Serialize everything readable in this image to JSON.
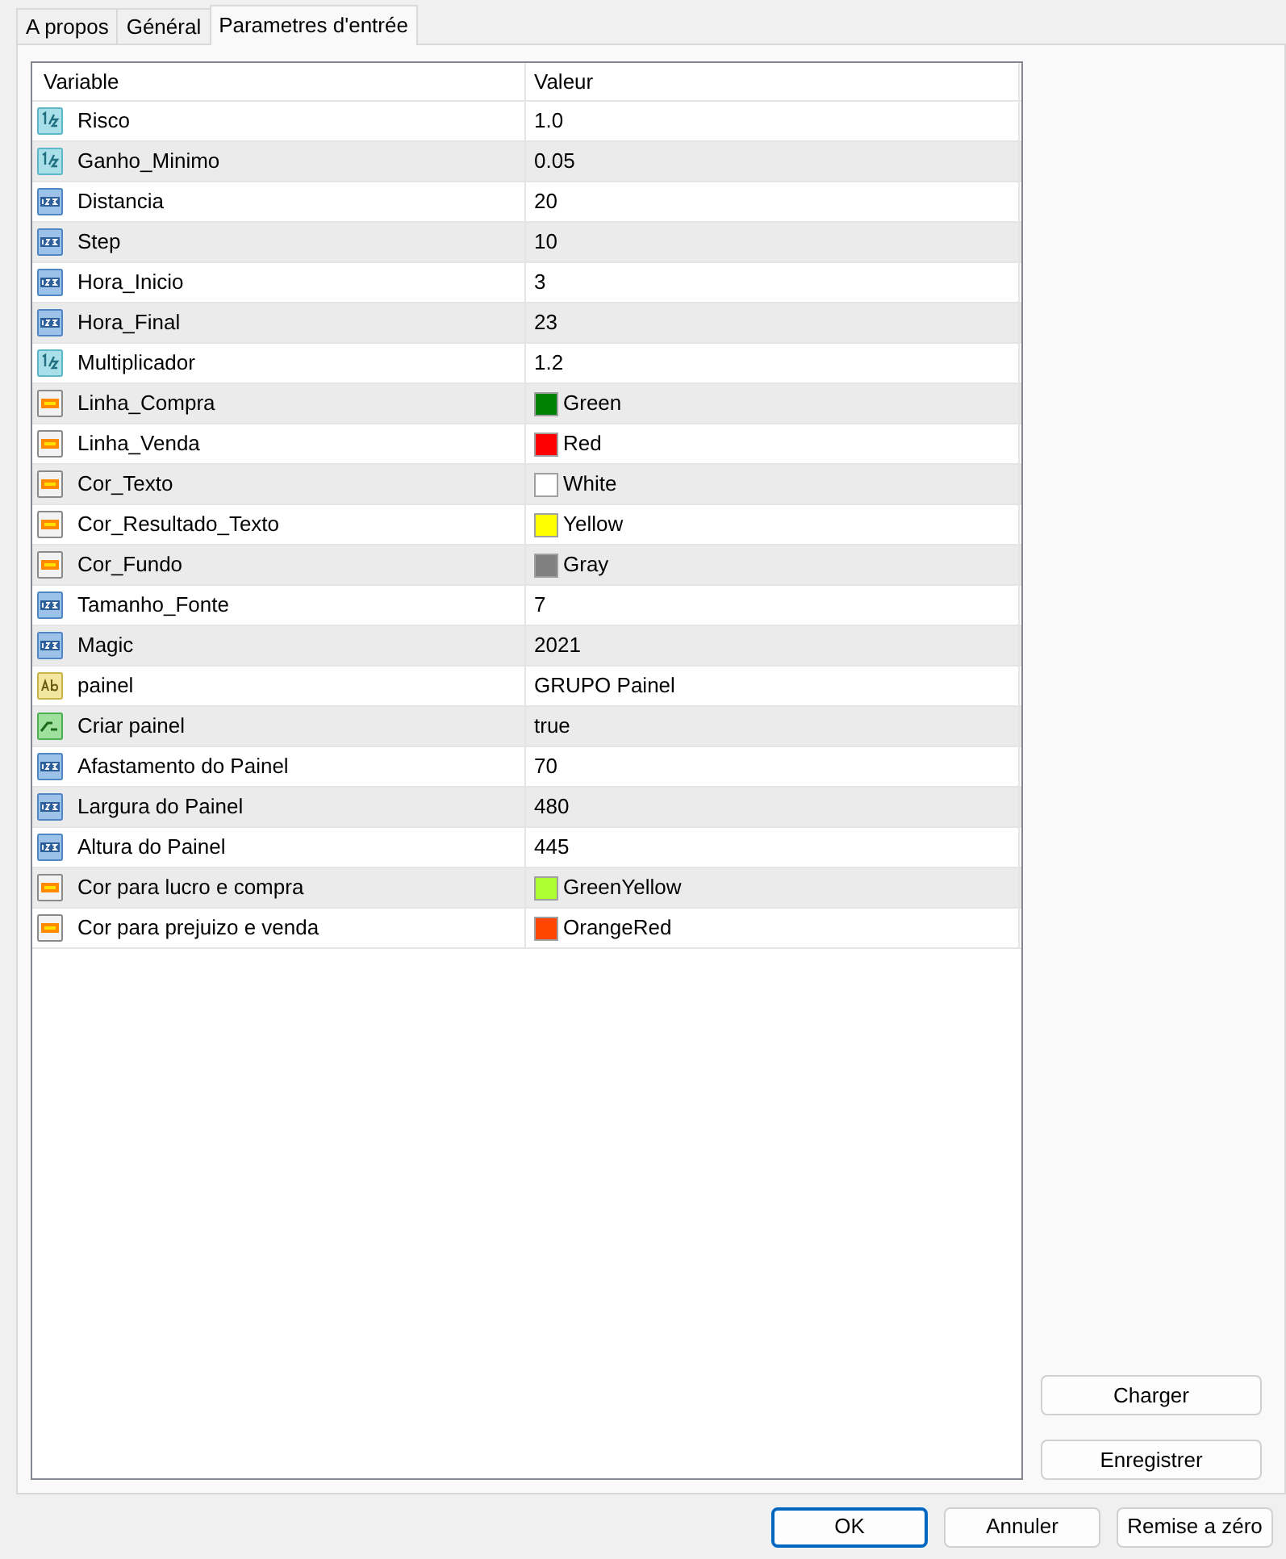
{
  "tabs": [
    {
      "label": "A propos",
      "selected": false
    },
    {
      "label": "Général",
      "selected": false
    },
    {
      "label": "Parametres d'entrée",
      "selected": true
    }
  ],
  "table": {
    "columns": [
      "Variable",
      "Valeur"
    ],
    "rows": [
      {
        "kind": "double",
        "variable": "Risco",
        "value": "1.0"
      },
      {
        "kind": "double",
        "variable": "Ganho_Minimo",
        "value": "0.05"
      },
      {
        "kind": "integer",
        "variable": "Distancia",
        "value": "20"
      },
      {
        "kind": "integer",
        "variable": "Step",
        "value": "10"
      },
      {
        "kind": "integer",
        "variable": "Hora_Inicio",
        "value": "3"
      },
      {
        "kind": "integer",
        "variable": "Hora_Final",
        "value": "23"
      },
      {
        "kind": "double",
        "variable": "Multiplicador",
        "value": "1.2"
      },
      {
        "kind": "color",
        "variable": "Linha_Compra",
        "value": "Green",
        "color": "#008000"
      },
      {
        "kind": "color",
        "variable": "Linha_Venda",
        "value": "Red",
        "color": "#ff0000"
      },
      {
        "kind": "color",
        "variable": "Cor_Texto",
        "value": "White",
        "color": "#ffffff"
      },
      {
        "kind": "color",
        "variable": "Cor_Resultado_Texto",
        "value": "Yellow",
        "color": "#ffff00"
      },
      {
        "kind": "color",
        "variable": "Cor_Fundo",
        "value": "Gray",
        "color": "#808080"
      },
      {
        "kind": "integer",
        "variable": "Tamanho_Fonte",
        "value": "7"
      },
      {
        "kind": "integer",
        "variable": "Magic",
        "value": "2021"
      },
      {
        "kind": "string",
        "variable": "painel",
        "value": "GRUPO Painel"
      },
      {
        "kind": "bool",
        "variable": "Criar painel",
        "value": "true"
      },
      {
        "kind": "integer",
        "variable": "Afastamento do Painel",
        "value": "70"
      },
      {
        "kind": "integer",
        "variable": "Largura do Painel",
        "value": "480"
      },
      {
        "kind": "integer",
        "variable": "Altura do Painel",
        "value": "445"
      },
      {
        "kind": "color",
        "variable": "Cor para lucro e compra",
        "value": "GreenYellow",
        "color": "#adff2f"
      },
      {
        "kind": "color",
        "variable": "Cor para prejuizo e venda",
        "value": "OrangeRed",
        "color": "#ff4500"
      }
    ]
  },
  "side_buttons": [
    "Charger",
    "Enregistrer"
  ],
  "buttons": [
    {
      "label": "OK",
      "default": true
    },
    {
      "label": "Annuler",
      "default": false
    },
    {
      "label": "Remise a zéro",
      "default": false
    }
  ]
}
